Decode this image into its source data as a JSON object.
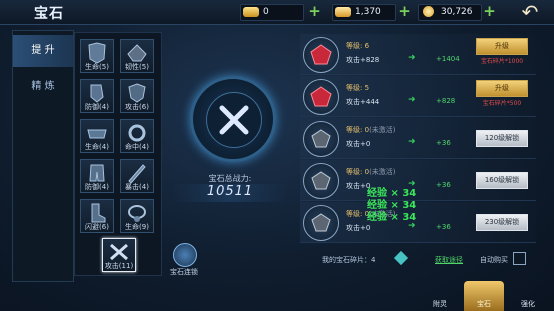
{
  "header": {
    "title": "宝石",
    "resources": [
      {
        "icon": "gold-ingot-icon",
        "value": "0"
      },
      {
        "icon": "silver-ingot-icon",
        "value": "1,370"
      },
      {
        "icon": "coin-icon",
        "value": "30,726"
      }
    ]
  },
  "nav": {
    "tabs": [
      "提 升",
      "精 炼"
    ]
  },
  "slots": [
    {
      "label": "生命(5)"
    },
    {
      "label": "韧性(5)"
    },
    {
      "label": "防御(4)"
    },
    {
      "label": "攻击(6)"
    },
    {
      "label": "生命(4)"
    },
    {
      "label": "命中(4)"
    },
    {
      "label": "防御(4)"
    },
    {
      "label": "暴击(4)"
    },
    {
      "label": "闪避(6)"
    },
    {
      "label": "生命(9)"
    },
    {
      "label": "攻击(11)"
    }
  ],
  "center": {
    "power_label": "宝石总战力:",
    "power_value": "10511",
    "link_label": "宝石连锁"
  },
  "gems": [
    {
      "level_label": "等级:",
      "level": "6",
      "status": "",
      "attack": "攻击+828",
      "gain": "+1404",
      "button": "升级",
      "sub": "宝石碎片*1000",
      "color": "red"
    },
    {
      "level_label": "等级:",
      "level": "5",
      "status": "",
      "attack": "攻击+444",
      "gain": "+828",
      "button": "升级",
      "sub": "宝石碎片*500",
      "color": "red"
    },
    {
      "level_label": "等级:",
      "level": "0",
      "status": "(未激活)",
      "attack": "攻击+0",
      "gain": "+36",
      "button": "120级解锁",
      "sub": "",
      "color": "gray"
    },
    {
      "level_label": "等级:",
      "level": "0",
      "status": "(未激活)",
      "attack": "攻击+0",
      "gain": "+36",
      "button": "160级解锁",
      "sub": "",
      "color": "gray"
    },
    {
      "level_label": "等级:",
      "level": "0",
      "status": "(未激活)",
      "attack": "攻击+0",
      "gain": "+36",
      "button": "230级解锁",
      "sub": "",
      "color": "gray"
    }
  ],
  "overlay": [
    "经验 × 34",
    "经验 × 34",
    "经验 × 34"
  ],
  "footer": {
    "shards": "我的宝石碎片：4",
    "source": "获取途径",
    "auto": "自动购买"
  },
  "bottom_tabs": [
    "附灵",
    "宝石",
    "强化"
  ],
  "colors": {
    "gem_red": "#c8283a",
    "gem_gray": "#5b6672",
    "accent_gold": "#e6c06b",
    "gain_green": "#4fd66a"
  }
}
